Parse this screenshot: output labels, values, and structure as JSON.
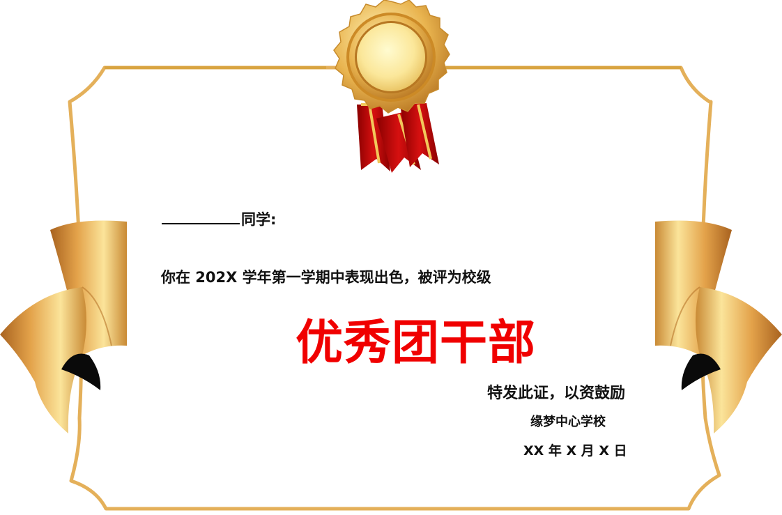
{
  "certificate": {
    "salutation_suffix": "同学:",
    "body_text": "你在 202X 学年第一学期中表现出色，被评为校级",
    "award_title": "优秀团干部",
    "issue_line": "特发此证，以资鼓励",
    "school_name": "缘梦中心学校",
    "issue_date": "XX 年 X 月 X 日"
  },
  "icons": {
    "seal": "gold-medal-seal-icon",
    "ribbon": "red-ribbon-icon"
  },
  "colors": {
    "frame_gold": "#d9a441",
    "award_red": "#f00000",
    "ribbon_red": "#c10a0a",
    "text": "#111111"
  }
}
